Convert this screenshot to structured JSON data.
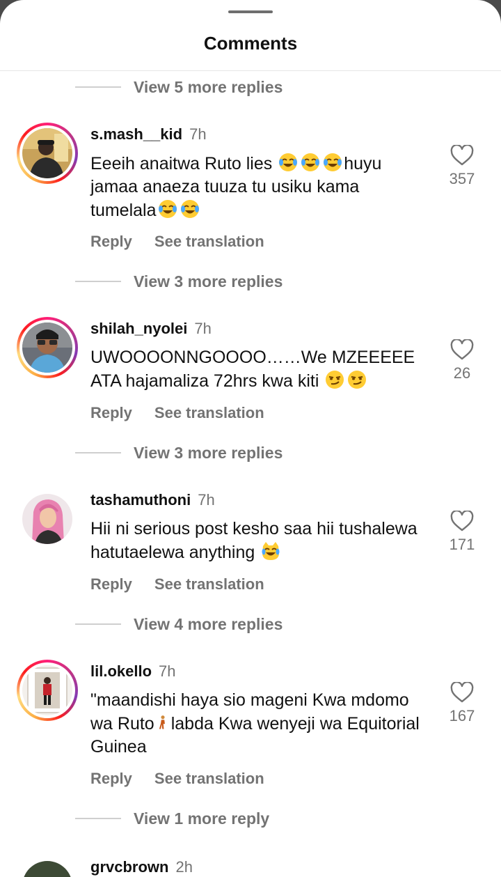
{
  "header": {
    "title": "Comments"
  },
  "replies_top": "View 5 more replies",
  "comments": [
    {
      "username": "s.mash__kid",
      "time": "7h",
      "text_1": "Eeeih anaitwa Ruto lies ",
      "text_2": "huyu jamaa anaeza tuuza tu usiku kama tumelala",
      "emoji_1": "tears-of-joy",
      "emoji_2": "tears-of-joy",
      "likes": "357",
      "reply": "Reply",
      "translate": "See translation",
      "replies": "View 3 more replies"
    },
    {
      "username": "shilah_nyolei",
      "time": "7h",
      "text_1": "UWOOOONNGOOOO……We MZEEEEE ATA hajamaliza 72hrs kwa kiti ",
      "emoji_1": "smirking-face",
      "likes": "26",
      "reply": "Reply",
      "translate": "See translation",
      "replies": "View 3 more replies"
    },
    {
      "username": "tashamuthoni",
      "time": "7h",
      "text_1": "Hii ni serious post kesho saa hii tushalewa hatutaelewa anything ",
      "emoji_1": "grinning-cat-tears-of-joy",
      "likes": "171",
      "reply": "Reply",
      "translate": "See translation",
      "replies": "View 4 more replies"
    },
    {
      "username": "lil.okello",
      "time": "7h",
      "text_1": "\"maandishi haya sio mageni Kwa mdomo wa Ruto",
      "text_2": "labda Kwa wenyeji wa Equitorial Guinea",
      "emoji_1": "person-walking",
      "likes": "167",
      "reply": "Reply",
      "translate": "See translation",
      "replies": "View 1 more reply"
    },
    {
      "username": "grvcbrown",
      "time": "2h"
    }
  ],
  "colors": {
    "secondary_text": "#737373",
    "primary_text": "#111111",
    "story_ring": "#c13584"
  },
  "icons": [
    "heart-outline-icon"
  ]
}
